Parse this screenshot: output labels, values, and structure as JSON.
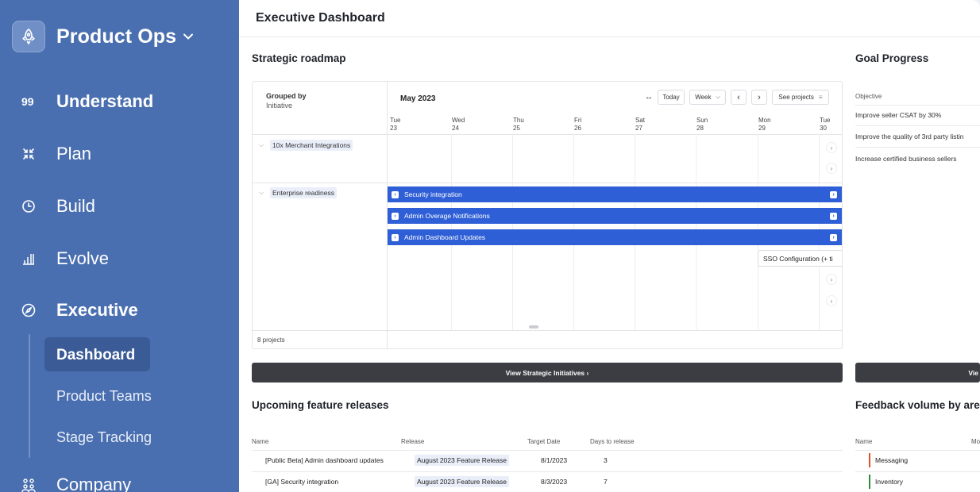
{
  "sidebar": {
    "brand": "Product Ops",
    "nav": [
      {
        "label": "Understand",
        "icon": "quote-icon"
      },
      {
        "label": "Plan",
        "icon": "collapse-arrows-icon"
      },
      {
        "label": "Build",
        "icon": "clock-icon"
      },
      {
        "label": "Evolve",
        "icon": "bar-chart-icon"
      },
      {
        "label": "Executive",
        "icon": "compass-icon"
      },
      {
        "label": "Company",
        "icon": "people-group-icon"
      }
    ],
    "sub_items": [
      "Dashboard",
      "Product Teams",
      "Stage Tracking"
    ]
  },
  "header": {
    "title": "Executive Dashboard"
  },
  "roadmap": {
    "title": "Strategic roadmap",
    "grouped_by_label": "Grouped by",
    "grouped_by_value": "Initiative",
    "month": "May 2023",
    "controls": {
      "expand": "↔",
      "today": "Today",
      "week": "Week",
      "prev": "‹",
      "next": "›",
      "see_projects": "See projects"
    },
    "days": [
      {
        "dow": "Tue",
        "date": "23"
      },
      {
        "dow": "Wed",
        "date": "24"
      },
      {
        "dow": "Thu",
        "date": "25"
      },
      {
        "dow": "Fri",
        "date": "26"
      },
      {
        "dow": "Sat",
        "date": "27"
      },
      {
        "dow": "Sun",
        "date": "28"
      },
      {
        "dow": "Mon",
        "date": "29"
      },
      {
        "dow": "Tue",
        "date": "30"
      }
    ],
    "groups": [
      "10x Merchant Integrations",
      "Enterprise readiness"
    ],
    "bars": [
      "Security integration",
      "Admin Overage Notifications",
      "Admin Dashboard Updates"
    ],
    "sso_card": "SSO Configuration (+ ti",
    "footer": "8 projects",
    "button": "View Strategic Initiatives  ›"
  },
  "goals": {
    "title": "Goal Progress",
    "column": "Objective",
    "rows": [
      "Improve seller CSAT by 30%",
      "Improve the quality of 3rd party listin",
      "Increase certified business sellers"
    ],
    "button": "Vie"
  },
  "releases": {
    "title": "Upcoming feature releases",
    "columns": [
      "Name",
      "Release",
      "Target Date",
      "Days to release"
    ],
    "rows": [
      {
        "name": "[Public Beta] Admin dashboard updates",
        "release": "August 2023 Feature Release",
        "date": "8/1/2023",
        "days": "3"
      },
      {
        "name": "[GA] Security integration",
        "release": "August 2023 Feature Release",
        "date": "8/3/2023",
        "days": "7"
      }
    ]
  },
  "feedback": {
    "title": "Feedback volume by are",
    "columns": [
      "Name",
      "Mo"
    ],
    "rows": [
      {
        "name": "Messaging",
        "color": "#d9541e"
      },
      {
        "name": "Inventory",
        "color": "#2e8b3a"
      }
    ]
  },
  "colors": {
    "sidebar": "#4a6fb0",
    "bar": "#2f5fd6",
    "dark_button": "#3b3d42"
  }
}
